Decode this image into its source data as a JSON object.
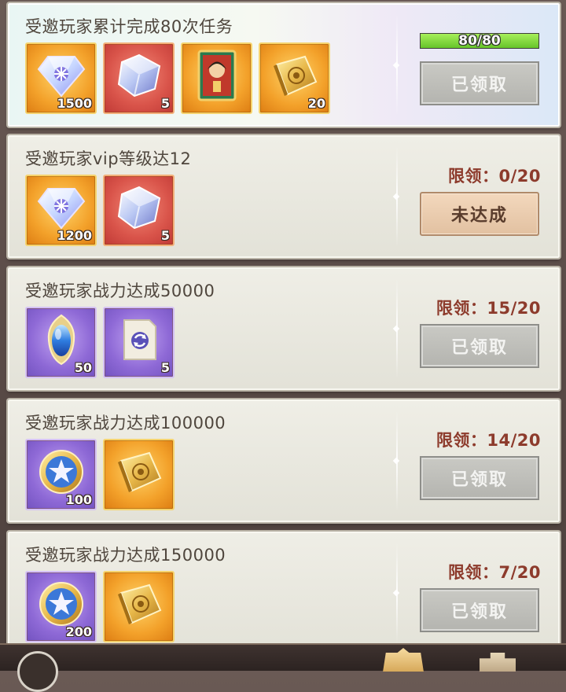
{
  "tasks": [
    {
      "title": "受邀玩家累计完成80次任务",
      "progress_text": "80/80",
      "progress_fraction": 1.0,
      "button": "已领取",
      "rewards": [
        {
          "icon": "diamond-icon",
          "bg": "gold",
          "qty": "1500"
        },
        {
          "icon": "crystal-cube-icon",
          "bg": "red",
          "qty": "5"
        },
        {
          "icon": "hero-card-icon",
          "bg": "gold",
          "qty": ""
        },
        {
          "icon": "gold-book-icon",
          "bg": "gold",
          "qty": "20"
        }
      ]
    },
    {
      "title": "受邀玩家vip等级达12",
      "limit": "限领：0/20",
      "button": "未达成",
      "rewards": [
        {
          "icon": "diamond-icon",
          "bg": "gold",
          "qty": "1200"
        },
        {
          "icon": "crystal-cube-icon",
          "bg": "red",
          "qty": "5"
        }
      ]
    },
    {
      "title": "受邀玩家战力达成50000",
      "limit": "限领：15/20",
      "button": "已领取",
      "rewards": [
        {
          "icon": "blue-gem-icon",
          "bg": "purple",
          "qty": "50"
        },
        {
          "icon": "refresh-scroll-icon",
          "bg": "purple",
          "qty": "5"
        }
      ]
    },
    {
      "title": "受邀玩家战力达成100000",
      "limit": "限领：14/20",
      "button": "已领取",
      "rewards": [
        {
          "icon": "star-medal-icon",
          "bg": "purple",
          "qty": "100"
        },
        {
          "icon": "gold-book-icon",
          "bg": "gold",
          "qty": ""
        }
      ]
    },
    {
      "title": "受邀玩家战力达成150000",
      "limit": "限领：7/20",
      "button": "已领取",
      "rewards": [
        {
          "icon": "star-medal-icon",
          "bg": "purple",
          "qty": "200"
        },
        {
          "icon": "gold-book-icon",
          "bg": "gold",
          "qty": ""
        }
      ]
    }
  ],
  "colors": {
    "limit_text": "#8d3b2c",
    "progress_fill": "#7fd63a",
    "button_disabled": "#bdbdb8",
    "button_notyet": "#ecccae"
  }
}
